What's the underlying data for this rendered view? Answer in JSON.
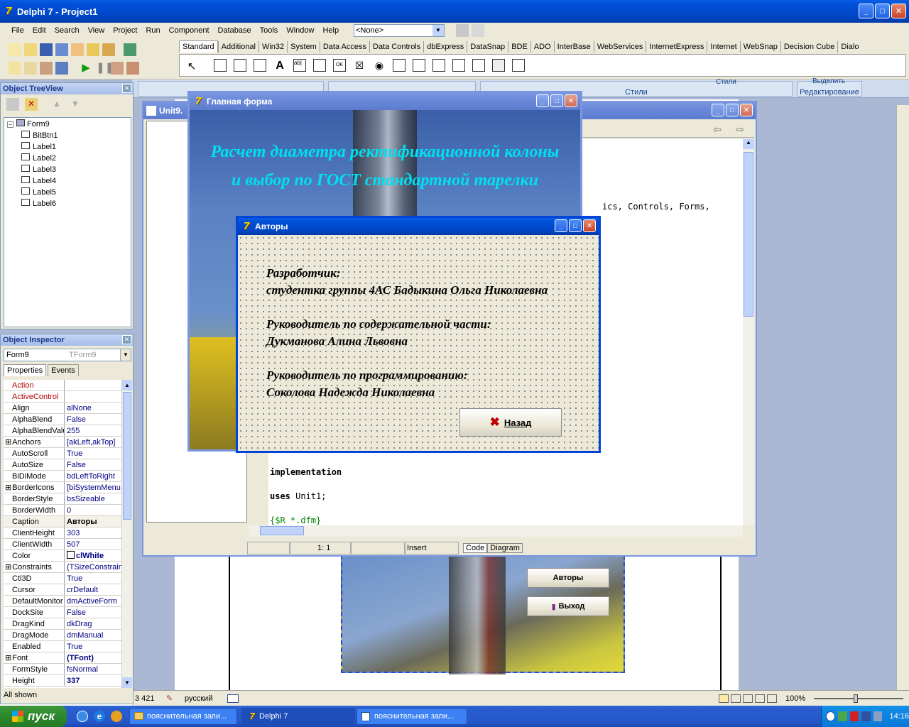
{
  "main_window": {
    "title": "Delphi 7 - Project1"
  },
  "menu": [
    "File",
    "Edit",
    "Search",
    "View",
    "Project",
    "Run",
    "Component",
    "Database",
    "Tools",
    "Window",
    "Help"
  ],
  "toolbar": {
    "combo_value": "<None>"
  },
  "palette_tabs": [
    "Standard",
    "Additional",
    "Win32",
    "System",
    "Data Access",
    "Data Controls",
    "dbExpress",
    "DataSnap",
    "BDE",
    "ADO",
    "InterBase",
    "WebServices",
    "InternetExpress",
    "Internet",
    "WebSnap",
    "Decision Cube",
    "Dialo"
  ],
  "word_ribbon": {
    "styles_label": "Стили",
    "edit_label": "Редактирование",
    "styles_btn": "Стили",
    "select_btn": "Выделить"
  },
  "tree_view": {
    "title": "Object TreeView",
    "root": "Form9",
    "items": [
      "BitBtn1",
      "Label1",
      "Label2",
      "Label3",
      "Label4",
      "Label5",
      "Label6"
    ]
  },
  "object_inspector": {
    "title": "Object Inspector",
    "selector_name": "Form9",
    "selector_type": "TForm9",
    "tabs": [
      "Properties",
      "Events"
    ],
    "properties": [
      {
        "name": "Action",
        "value": ""
      },
      {
        "name": "ActiveControl",
        "value": ""
      },
      {
        "name": "Align",
        "value": "alNone"
      },
      {
        "name": "AlphaBlend",
        "value": "False"
      },
      {
        "name": "AlphaBlendValu",
        "value": "255"
      },
      {
        "name": "Anchors",
        "value": "[akLeft,akTop]"
      },
      {
        "name": "AutoScroll",
        "value": "True"
      },
      {
        "name": "AutoSize",
        "value": "False"
      },
      {
        "name": "BiDiMode",
        "value": "bdLeftToRight"
      },
      {
        "name": "BorderIcons",
        "value": "[biSystemMenu,"
      },
      {
        "name": "BorderStyle",
        "value": "bsSizeable"
      },
      {
        "name": "BorderWidth",
        "value": "0"
      },
      {
        "name": "Caption",
        "value": "Авторы"
      },
      {
        "name": "ClientHeight",
        "value": "303"
      },
      {
        "name": "ClientWidth",
        "value": "507"
      },
      {
        "name": "Color",
        "value": "clWhite"
      },
      {
        "name": "Constraints",
        "value": "(TSizeConstrain"
      },
      {
        "name": "Ctl3D",
        "value": "True"
      },
      {
        "name": "Cursor",
        "value": "crDefault"
      },
      {
        "name": "DefaultMonitor",
        "value": "dmActiveForm"
      },
      {
        "name": "DockSite",
        "value": "False"
      },
      {
        "name": "DragKind",
        "value": "dkDrag"
      },
      {
        "name": "DragMode",
        "value": "dmManual"
      },
      {
        "name": "Enabled",
        "value": "True"
      },
      {
        "name": "Font",
        "value": "(TFont)"
      },
      {
        "name": "FormStyle",
        "value": "fsNormal"
      },
      {
        "name": "Height",
        "value": "337"
      }
    ],
    "status": "All shown"
  },
  "editor": {
    "title": "Unit9.",
    "code_fragment": "ics, Controls, Forms,",
    "code_lines": [
      "implementation",
      "uses Unit1;",
      "{$R *.dfm}"
    ],
    "status_pos": "1:  1",
    "status_mode": "Insert",
    "tabs": [
      "Code",
      "Diagram"
    ]
  },
  "main_form": {
    "title": "Главная форма",
    "heading_line1": "Расчет диаметра ректификационной колоны",
    "heading_line2": "и выбор по ГОСТ стандартной тарелки"
  },
  "authors_dialog": {
    "title": "Авторы",
    "label1": "Разработчик:",
    "label2": "студентка группы 4АС Бадыкина Ольга Николаевна",
    "label3": "Руководитель по содержательной части:",
    "label4": "Дукманова Алина Львовна",
    "label5": "Руководитель по программированию:",
    "label6": "Соколова Надежда Николаевна",
    "back_button": "Назад"
  },
  "background_form": {
    "authors_button": "Авторы",
    "exit_button": "Выход"
  },
  "word_status": {
    "count": "3 421",
    "lang": "русский",
    "zoom": "100%"
  },
  "taskbar": {
    "start": "пуск",
    "tasks": [
      "пояснительная запи...",
      "Delphi 7",
      "пояснительная запи..."
    ],
    "clock": "14:16"
  }
}
